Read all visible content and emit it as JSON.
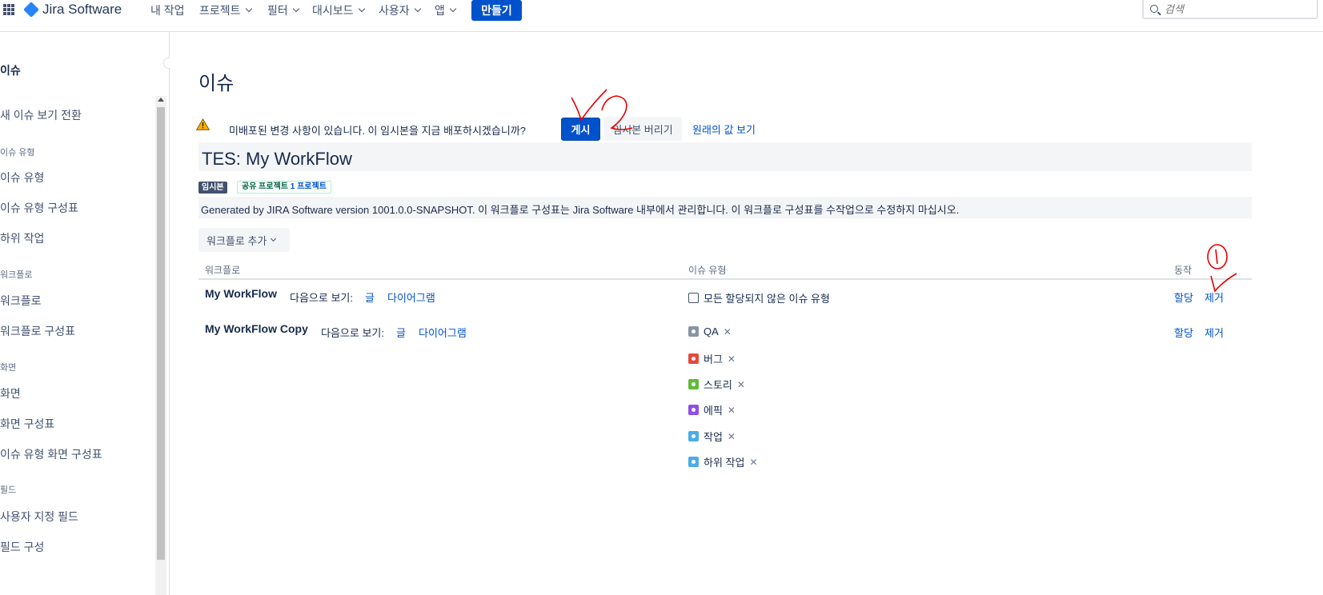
{
  "topnav": {
    "logo_text": "Jira Software",
    "items": [
      "내 작업",
      "프로젝트",
      "필터",
      "대시보드",
      "사용자",
      "앱"
    ],
    "create_label": "만들기",
    "search_placeholder": "검색"
  },
  "sidebar": {
    "title": "이슈",
    "items": [
      "새 이슈 보기 전환",
      "이슈 유형",
      "이슈 유형",
      "이슈 유형 구성표",
      "하위 작업",
      "워크플로",
      "워크플로",
      "워크플로 구성표",
      "화면",
      "화면",
      "화면 구성표",
      "이슈 유형 화면 구성표",
      "필드",
      "사용자 지정 필드",
      "필드 구성"
    ]
  },
  "main": {
    "page_title": "이슈",
    "warning": {
      "text": "미배포된 변경 사항이 있습니다. 이 임시본을 지금 배포하시겠습니까?",
      "publish_label": "게시",
      "discard_label": "임시본 버리기",
      "original_label": "원래의 값 보기"
    },
    "workflow_title": "TES: My WorkFlow",
    "draft_lozenge": "임시본",
    "shared_lozenge_prefix": "공유 프로젝트",
    "shared_lozenge_count": "1 프로젝트",
    "description": "Generated by JIRA Software version 1001.0.0-SNAPSHOT. 이 워크플로 구성표는 Jira Software 내부에서 관리합니다. 이 워크플로 구성표를 수작업으로 수정하지 마십시오.",
    "add_workflow_label": "워크플로 추가",
    "table": {
      "headers": [
        "워크플로",
        "이슈 유형",
        "동작"
      ],
      "rows": [
        {
          "name": "My WorkFlow",
          "view_label": "다음으로 보기:",
          "text_link": "글",
          "diagram_link": "다이어그램",
          "issue_types": [
            {
              "label": "모든 할당되지 않은 이슈 유형",
              "icon": "unassigned-types-icon"
            }
          ],
          "assign_label": "할당",
          "remove_label": "제거"
        },
        {
          "name": "My WorkFlow Copy",
          "view_label": "다음으로 보기:",
          "text_link": "글",
          "diagram_link": "다이어그램",
          "issue_types": [
            {
              "label": "QA",
              "icon": "qa-icon",
              "color": "#8993a4"
            },
            {
              "label": "버그",
              "icon": "bug-icon",
              "color": "#e5493a"
            },
            {
              "label": "스토리",
              "icon": "story-icon",
              "color": "#63ba3c"
            },
            {
              "label": "에픽",
              "icon": "epic-icon",
              "color": "#904ee2"
            },
            {
              "label": "작업",
              "icon": "task-icon",
              "color": "#4bade8"
            },
            {
              "label": "하위 작업",
              "icon": "subtask-icon",
              "color": "#4bade8"
            }
          ],
          "remove_symbol": "✕",
          "assign_label": "할당",
          "remove_label": "제거"
        }
      ]
    }
  },
  "colors": {
    "primary": "#0052cc",
    "text": "#172b4d",
    "annotation": "#e60000"
  }
}
